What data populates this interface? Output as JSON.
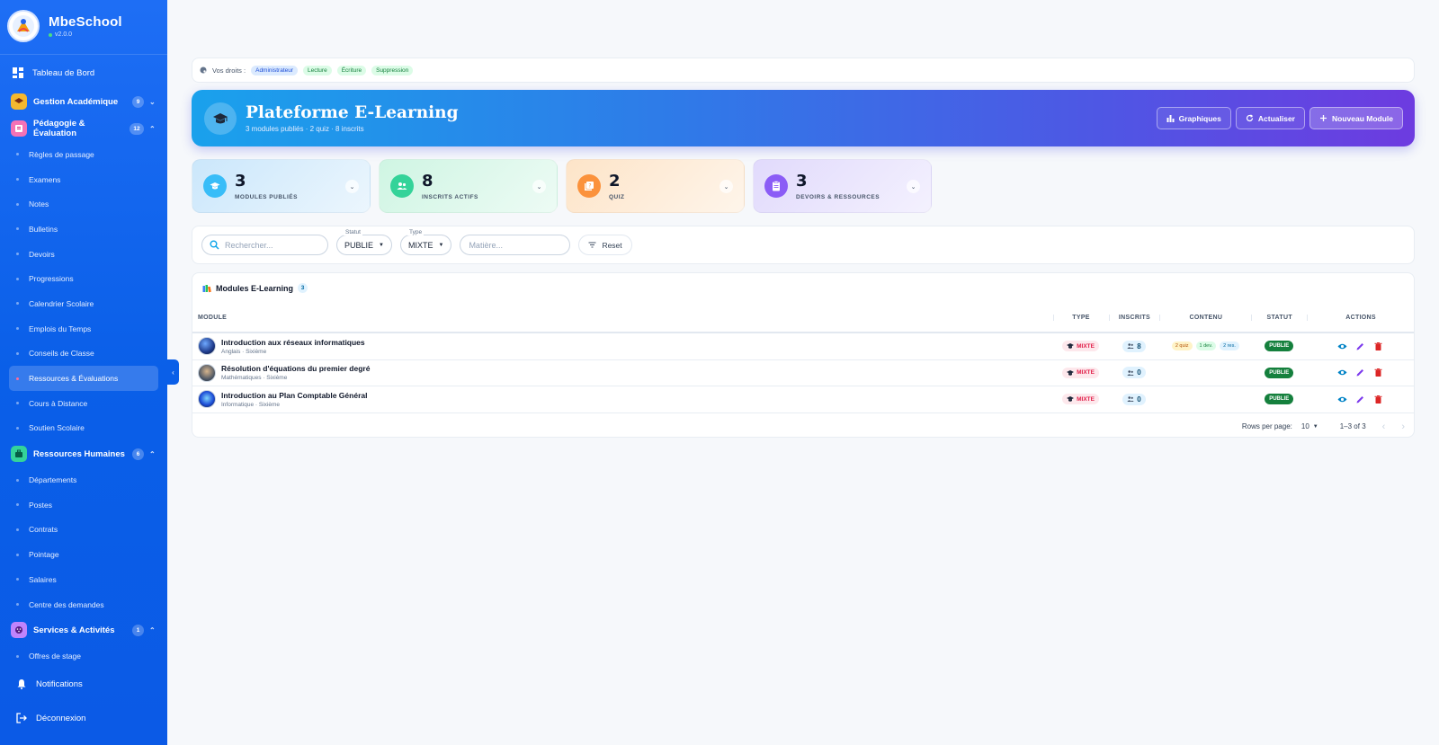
{
  "brand": {
    "name": "MbeSchool",
    "version": "v2.0.0"
  },
  "sidebar": {
    "dashboard": "Tableau de Bord",
    "groups": [
      {
        "label": "Gestion Académique",
        "count": "9",
        "color": "#f5b82e"
      },
      {
        "label": "Pédagogie & Évaluation",
        "count": "12",
        "color": "#f472b6"
      },
      {
        "label": "Ressources Humaines",
        "count": "6",
        "color": "#34d399"
      },
      {
        "label": "Services & Activités",
        "count": "1",
        "color": "#c084fc"
      }
    ],
    "pedagogie_items": [
      "Règles de passage",
      "Examens",
      "Notes",
      "Bulletins",
      "Devoirs",
      "Progressions",
      "Calendrier Scolaire",
      "Emplois du Temps",
      "Conseils de Classe",
      "Ressources & Évaluations",
      "Cours à Distance",
      "Soutien Scolaire"
    ],
    "rh_items": [
      "Départements",
      "Postes",
      "Contrats",
      "Pointage",
      "Salaires",
      "Centre des demandes"
    ],
    "services_items": [
      "Offres de stage"
    ],
    "notifications": "Notifications",
    "logout": "Déconnexion"
  },
  "rights": {
    "label": "Vos droits :",
    "chips": [
      {
        "text": "Administrateur",
        "bg": "#dbeafe",
        "fg": "#1d4ed8"
      },
      {
        "text": "Lecture",
        "bg": "#dcfce7",
        "fg": "#15803d"
      },
      {
        "text": "Écriture",
        "bg": "#dcfce7",
        "fg": "#15803d"
      },
      {
        "text": "Suppression",
        "bg": "#dcfce7",
        "fg": "#15803d"
      }
    ]
  },
  "hero": {
    "title": "Plateforme E-Learning",
    "subtitle": "3 modules publiés · 2 quiz · 8 inscrits",
    "buttons": {
      "charts": "Graphiques",
      "refresh": "Actualiser",
      "new": "Nouveau Module"
    }
  },
  "stats": [
    {
      "value": "3",
      "label": "MODULES PUBLIÉS",
      "icon": "graduation-cap",
      "bg": "#cbe7fb",
      "accent": "#38bdf8"
    },
    {
      "value": "8",
      "label": "INSCRITS ACTIFS",
      "icon": "people",
      "bg": "#cff5e3",
      "accent": "#34d399"
    },
    {
      "value": "2",
      "label": "QUIZ",
      "icon": "quiz",
      "bg": "#fde4c8",
      "accent": "#fb923c"
    },
    {
      "value": "3",
      "label": "DEVOIRS & RESSOURCES",
      "icon": "clipboard",
      "bg": "#e1dafc",
      "accent": "#8b5cf6"
    }
  ],
  "filters": {
    "search_placeholder": "Rechercher...",
    "status_label": "Statut",
    "status_value": "PUBLIE",
    "type_label": "Type",
    "type_value": "MIXTE",
    "subject_placeholder": "Matière...",
    "reset": "Reset"
  },
  "table": {
    "title": "Modules E-Learning",
    "count": "3",
    "headers": {
      "module": "MODULE",
      "type": "TYPE",
      "inscrits": "INSCRITS",
      "contenu": "CONTENU",
      "statut": "STATUT",
      "actions": "ACTIONS"
    },
    "rows": [
      {
        "title": "Introduction aux réseaux informatiques",
        "sub": "Anglais · Sixième",
        "type": "MIXTE",
        "inscrits": "8",
        "content": [
          "2 quiz",
          "1 dev.",
          "2 res."
        ],
        "status": "PUBLIE"
      },
      {
        "title": "Résolution d'équations du premier degré",
        "sub": "Mathématiques · Sixième",
        "type": "MIXTE",
        "inscrits": "0",
        "content": [],
        "status": "PUBLIE"
      },
      {
        "title": "Introduction au Plan Comptable Général",
        "sub": "Informatique · Sixième",
        "type": "MIXTE",
        "inscrits": "0",
        "content": [],
        "status": "PUBLIE"
      }
    ],
    "pager": {
      "rows_per_page": "Rows per page:",
      "rows_value": "10",
      "range": "1–3 of 3"
    }
  }
}
